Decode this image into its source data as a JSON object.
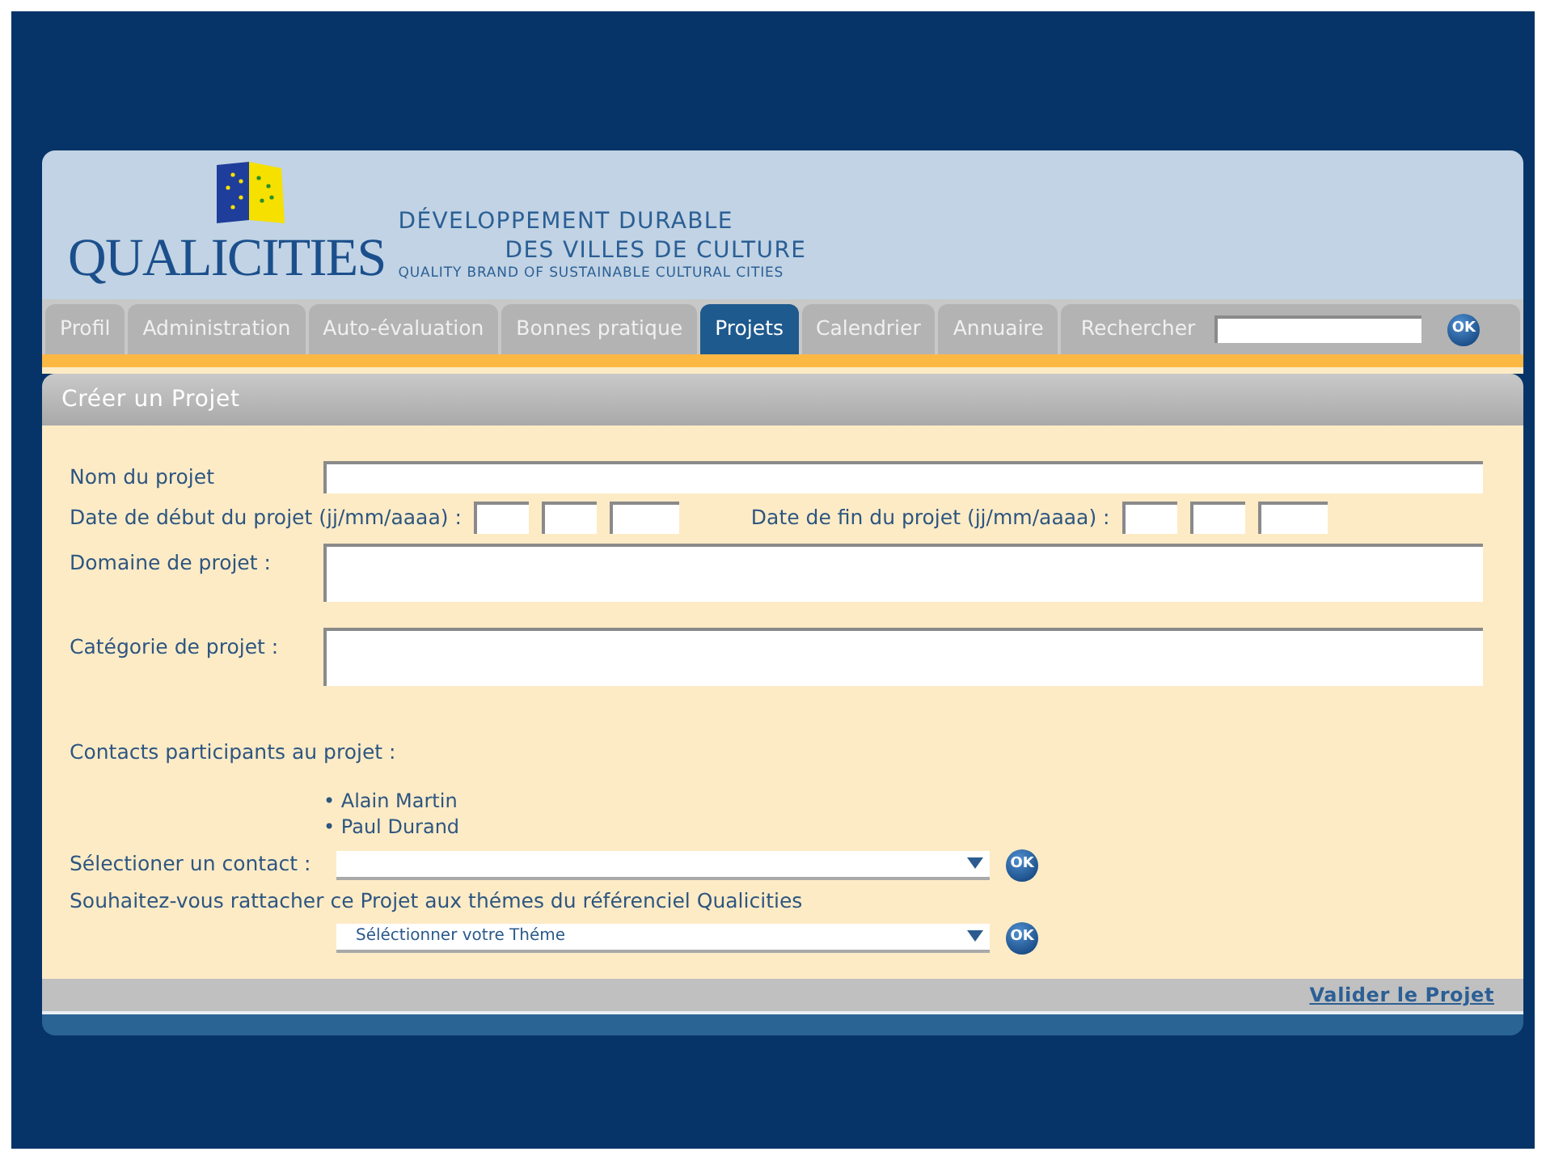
{
  "header": {
    "brand": "QUALICITIES",
    "tagline_1": "DÉVELOPPEMENT DURABLE",
    "tagline_2": "DES VILLES DE CULTURE",
    "tagline_3": "QUALITY BRAND OF SUSTAINABLE CULTURAL CITIES"
  },
  "tabs": [
    {
      "label": "Profil",
      "selected": false
    },
    {
      "label": "Administration",
      "selected": false
    },
    {
      "label": "Auto-évaluation",
      "selected": false
    },
    {
      "label": "Bonnes pratique",
      "selected": false
    },
    {
      "label": "Projets",
      "selected": true
    },
    {
      "label": "Calendrier",
      "selected": false
    },
    {
      "label": "Annuaire",
      "selected": false
    }
  ],
  "search": {
    "label": "Rechercher",
    "button": "OK"
  },
  "page_title": "Créer un Projet",
  "form": {
    "name_label": "Nom du projet",
    "start_label": "Date de début du projet (jj/mm/aaaa) :",
    "end_label": "Date de fin du projet (jj/mm/aaaa) :",
    "domain_label": "Domaine de projet :",
    "category_label": "Catégorie de projet :",
    "contacts_label": "Contacts participants au projet :",
    "contacts": [
      "• Alain Martin",
      "• Paul Durand"
    ],
    "select_contact_label": "Sélectioner un contact :",
    "select_contact_button": "OK",
    "theme_question": "Souhaitez-vous rattacher ce Projet aux thémes du référenciel Qualicities",
    "theme_select": "Séléctionner votre Théme",
    "theme_button": "OK"
  },
  "footer": {
    "link": "Valider le Projet"
  }
}
